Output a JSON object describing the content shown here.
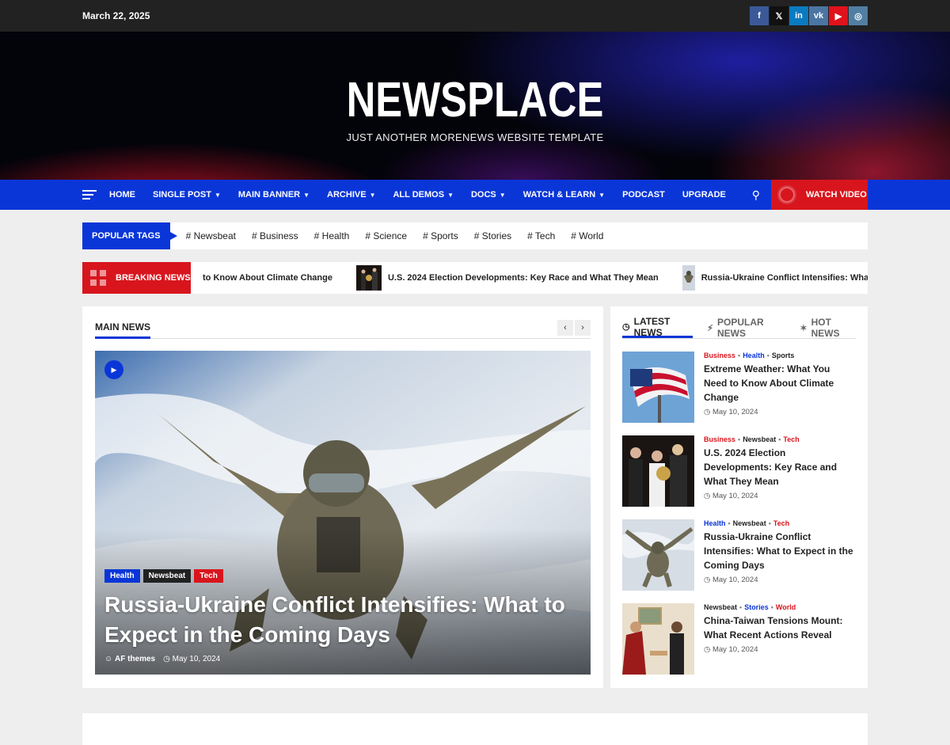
{
  "topbar": {
    "date": "March 22, 2025",
    "socials": [
      {
        "icon": "facebook-icon",
        "glyph": "f",
        "color": "#3b5998"
      },
      {
        "icon": "x-twitter-icon",
        "glyph": "𝕏",
        "color": "#111111"
      },
      {
        "icon": "linkedin-icon",
        "glyph": "in",
        "color": "#0a7ac1"
      },
      {
        "icon": "vk-icon",
        "glyph": "vk",
        "color": "#4c75a3"
      },
      {
        "icon": "youtube-icon",
        "glyph": "▶",
        "color": "#e0121b"
      },
      {
        "icon": "instagram-icon",
        "glyph": "◎",
        "color": "#517fa4"
      }
    ]
  },
  "header": {
    "title": "NEWSPLACE",
    "tagline": "JUST ANOTHER MORENEWS WEBSITE TEMPLATE"
  },
  "nav": {
    "items": [
      {
        "label": "HOME",
        "dropdown": false
      },
      {
        "label": "SINGLE POST",
        "dropdown": true
      },
      {
        "label": "MAIN BANNER",
        "dropdown": true
      },
      {
        "label": "ARCHIVE",
        "dropdown": true
      },
      {
        "label": "ALL DEMOS",
        "dropdown": true
      },
      {
        "label": "DOCS",
        "dropdown": true
      },
      {
        "label": "WATCH & LEARN",
        "dropdown": true
      },
      {
        "label": "PODCAST",
        "dropdown": false
      },
      {
        "label": "UPGRADE",
        "dropdown": false
      }
    ],
    "watch_label": "WATCH VIDEO"
  },
  "tags": {
    "label": "POPULAR TAGS",
    "items": [
      "# Newsbeat",
      "# Business",
      "# Health",
      "# Science",
      "# Sports",
      "# Stories",
      "# Tech",
      "# World"
    ]
  },
  "breaking": {
    "label": "BREAKING NEWS",
    "items": [
      "to Know About Climate Change",
      "U.S. 2024 Election Developments: Key Race and What They Mean",
      "Russia-Ukraine Conflict Intensifies: What to Expect in the Coming Days"
    ]
  },
  "main": {
    "section_title": "MAIN NEWS",
    "hero": {
      "categories": [
        {
          "label": "Health",
          "color": "#0a36d8"
        },
        {
          "label": "Newsbeat",
          "color": "#222222"
        },
        {
          "label": "Tech",
          "color": "#d8151d"
        }
      ],
      "title": "Russia-Ukraine Conflict Intensifies: What to Expect in the Coming Days",
      "author": "AF themes",
      "date": "May 10, 2024"
    }
  },
  "sidebar": {
    "tabs": [
      {
        "label": "LATEST NEWS",
        "icon": "clock-icon"
      },
      {
        "label": "POPULAR NEWS",
        "icon": "bolt-icon"
      },
      {
        "label": "HOT NEWS",
        "icon": "fire-icon"
      }
    ],
    "posts": [
      {
        "categories": [
          {
            "label": "Business",
            "color": "#d8151d"
          },
          {
            "label": "Health",
            "color": "#0a36d8"
          },
          {
            "label": "Sports",
            "color": "#222222"
          }
        ],
        "title": "Extreme Weather: What You Need to Know About Climate Change",
        "date": "May 10, 2024"
      },
      {
        "categories": [
          {
            "label": "Business",
            "color": "#d8151d"
          },
          {
            "label": "Newsbeat",
            "color": "#222222"
          },
          {
            "label": "Tech",
            "color": "#d8151d"
          }
        ],
        "title": "U.S. 2024 Election Developments: Key Race and What They Mean",
        "date": "May 10, 2024"
      },
      {
        "categories": [
          {
            "label": "Health",
            "color": "#0a36d8"
          },
          {
            "label": "Newsbeat",
            "color": "#222222"
          },
          {
            "label": "Tech",
            "color": "#d8151d"
          }
        ],
        "title": "Russia-Ukraine Conflict Intensifies: What to Expect in the Coming Days",
        "date": "May 10, 2024"
      },
      {
        "categories": [
          {
            "label": "Newsbeat",
            "color": "#222222"
          },
          {
            "label": "Stories",
            "color": "#0a36d8"
          },
          {
            "label": "World",
            "color": "#d8151d"
          }
        ],
        "title": "China-Taiwan Tensions Mount: What Recent Actions Reveal",
        "date": "May 10, 2024"
      }
    ]
  },
  "colors": {
    "accent_blue": "#0a36d8",
    "accent_red": "#d8151d",
    "topbar": "#222222"
  }
}
